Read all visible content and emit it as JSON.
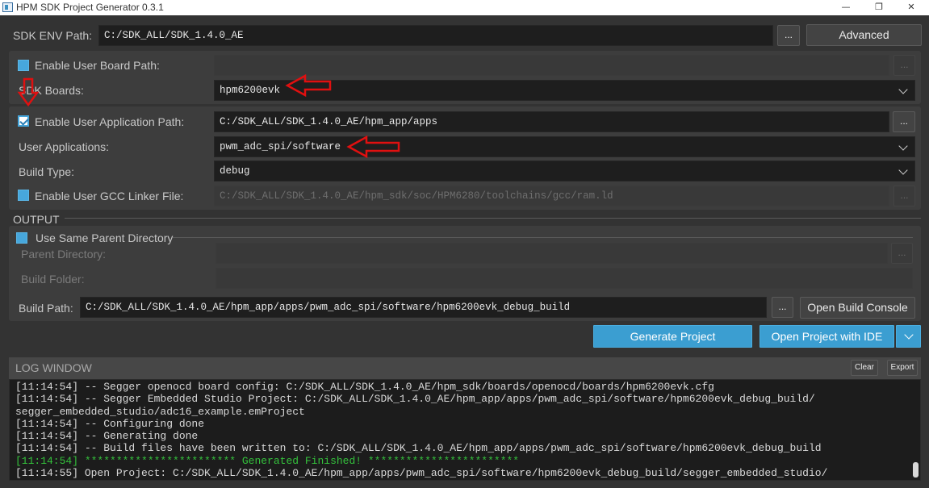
{
  "window": {
    "title": "HPM SDK Project Generator 0.3.1",
    "minimize": "—",
    "restore": "❐",
    "close": "✕"
  },
  "sdk_env": {
    "label": "SDK ENV Path:",
    "value": "C:/SDK_ALL/SDK_1.4.0_AE",
    "browse": "...",
    "advanced": "Advanced"
  },
  "board": {
    "user_board_label": "Enable User Board Path:",
    "user_board_checked": false,
    "user_board_value": "",
    "browse": "...",
    "boards_label": "SDK Boards:",
    "boards_value": "hpm6200evk"
  },
  "application": {
    "user_app_label": "Enable User Application Path:",
    "user_app_checked": true,
    "user_app_value": "C:/SDK_ALL/SDK_1.4.0_AE/hpm_app/apps",
    "browse": "...",
    "apps_label": "User Applications:",
    "apps_value": "pwm_adc_spi/software",
    "build_type_label": "Build Type:",
    "build_type_value": "debug",
    "linker_label": "Enable User GCC Linker File:",
    "linker_checked": false,
    "linker_value": "C:/SDK_ALL/SDK_1.4.0_AE/hpm_sdk/soc/HPM6280/toolchains/gcc/ram.ld",
    "linker_browse": "..."
  },
  "output": {
    "section_label": "OUTPUT",
    "same_parent_label": "Use Same Parent Directory",
    "same_parent_checked": false,
    "parent_dir_label": "Parent Directory:",
    "parent_dir_value": "",
    "parent_browse": "...",
    "build_folder_label": "Build Folder:",
    "build_folder_value": "",
    "build_path_label": "Build Path:",
    "build_path_value": "C:/SDK_ALL/SDK_1.4.0_AE/hpm_app/apps/pwm_adc_spi/software/hpm6200evk_debug_build",
    "build_path_browse": "...",
    "open_console": "Open Build Console"
  },
  "actions": {
    "generate": "Generate Project",
    "open_ide": "Open Project with IDE"
  },
  "log": {
    "title": "LOG WINDOW",
    "clear": "Clear",
    "export": "Export",
    "lines": [
      "[11:14:54] -- Segger openocd board config: C:/SDK_ALL/SDK_1.4.0_AE/hpm_sdk/boards/openocd/boards/hpm6200evk.cfg",
      "[11:14:54] -- Segger Embedded Studio Project: C:/SDK_ALL/SDK_1.4.0_AE/hpm_app/apps/pwm_adc_spi/software/hpm6200evk_debug_build/",
      "segger_embedded_studio/adc16_example.emProject",
      "[11:14:54] -- Configuring done",
      "[11:14:54] -- Generating done",
      "[11:14:54] -- Build files have been written to: C:/SDK_ALL/SDK_1.4.0_AE/hpm_app/apps/pwm_adc_spi/software/hpm6200evk_debug_build",
      "[11:14:54] ************************ Generated Finished! ************************",
      "[11:14:55] Open Project: C:/SDK_ALL/SDK_1.4.0_AE/hpm_app/apps/pwm_adc_spi/software/hpm6200evk_debug_build/segger_embedded_studio/"
    ]
  },
  "colors": {
    "background": "#333333",
    "accent": "#3b9ed1",
    "annotation_arrow": "#e01010",
    "log_success": "#34c23c"
  }
}
